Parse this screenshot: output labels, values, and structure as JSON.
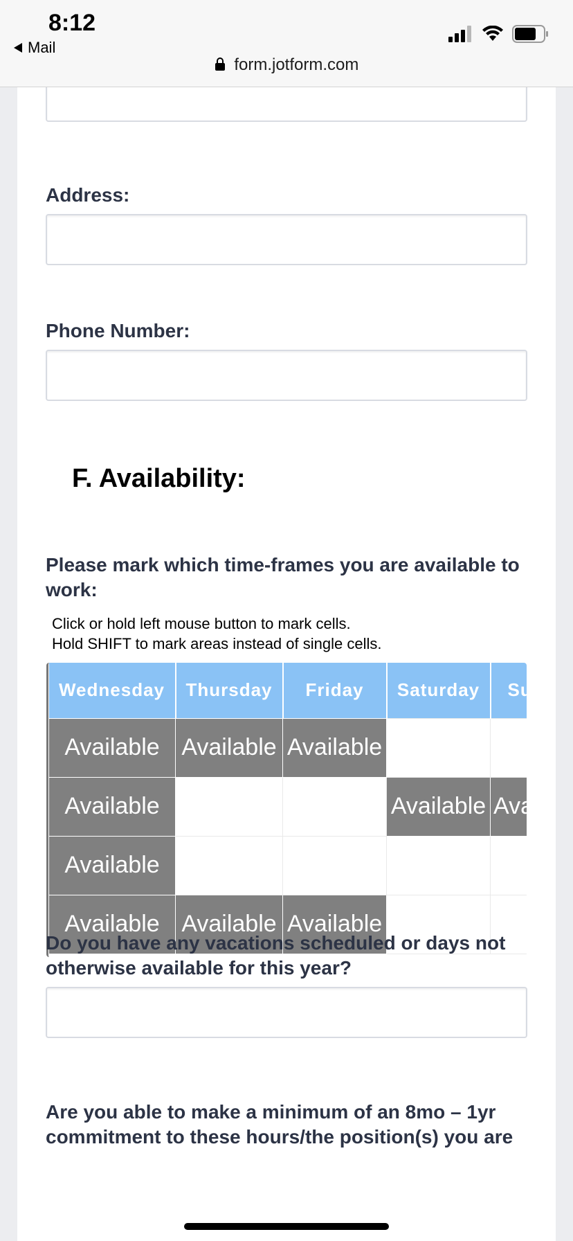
{
  "status": {
    "time": "8:12",
    "back_label": "Mail",
    "url": "form.jotform.com"
  },
  "form": {
    "address_label": "Address:",
    "phone_label": "Phone Number:",
    "section_title": "F. Availability:",
    "availability_question": "Please mark which time-frames you are available to work:",
    "hint_line1": "Click or hold left mouse button to mark cells.",
    "hint_line2": "Hold SHIFT to mark areas instead of single cells.",
    "matrix": {
      "columns": [
        "Wednesday",
        "Thursday",
        "Friday",
        "Saturday",
        "Su"
      ],
      "cell_label": "Available",
      "rows": [
        [
          true,
          true,
          true,
          false,
          false
        ],
        [
          true,
          false,
          false,
          true,
          true
        ],
        [
          true,
          false,
          false,
          false,
          false
        ],
        [
          true,
          true,
          true,
          false,
          false
        ]
      ]
    },
    "vacation_question": "Do you have any vacations scheduled or days not otherwise available for this year?",
    "commitment_question": "Are you able to make a minimum of an 8mo – 1yr commitment to these hours/the position(s) you are"
  },
  "colors": {
    "header_blue": "#8ac2f5",
    "selected_gray": "#808080",
    "label_navy": "#2c3345"
  }
}
